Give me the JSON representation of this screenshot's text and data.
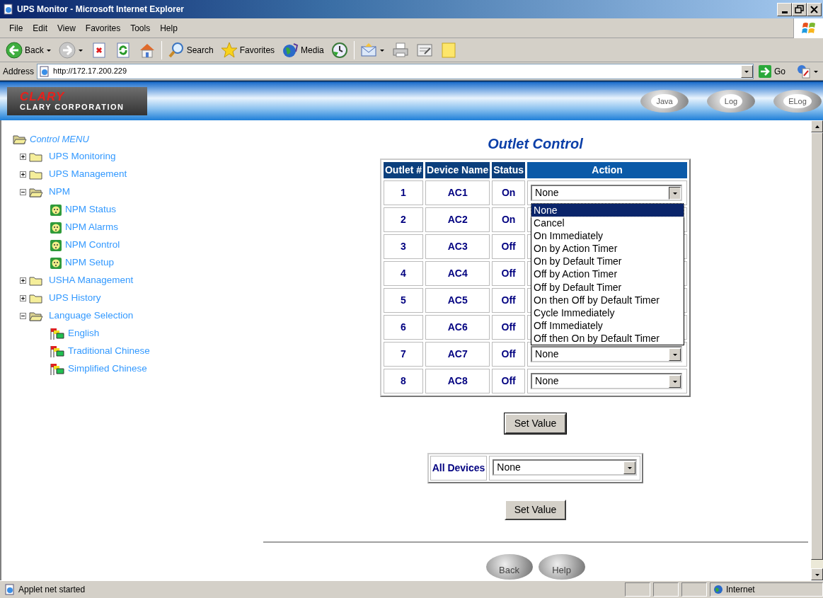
{
  "window": {
    "title": "UPS Monitor - Microsoft Internet Explorer"
  },
  "menu_bar": [
    "File",
    "Edit",
    "View",
    "Favorites",
    "Tools",
    "Help"
  ],
  "toolbar": [
    {
      "kind": "back",
      "label": "Back"
    },
    {
      "kind": "forward"
    },
    {
      "kind": "stop"
    },
    {
      "kind": "refresh"
    },
    {
      "kind": "home"
    },
    {
      "kind": "search",
      "label": "Search"
    },
    {
      "kind": "favorites",
      "label": "Favorites"
    },
    {
      "kind": "media",
      "label": "Media"
    },
    {
      "kind": "history"
    },
    {
      "kind": "mail"
    },
    {
      "kind": "print"
    },
    {
      "kind": "edit"
    },
    {
      "kind": "note"
    }
  ],
  "address_bar": {
    "label": "Address",
    "url": "http://172.17.200.229",
    "go": "Go"
  },
  "header": {
    "logo_mark": "CLARY",
    "logo_text": "CLARY CORPORATION",
    "buttons": [
      "Java",
      "Log",
      "ELog"
    ]
  },
  "sidebar": {
    "root": "Control MENU",
    "items": [
      {
        "label": "UPS Monitoring",
        "expanded": false
      },
      {
        "label": "UPS Management",
        "expanded": false
      },
      {
        "label": "NPM",
        "expanded": true,
        "children": [
          {
            "label": "NPM Status",
            "kind": "outlet"
          },
          {
            "label": "NPM Alarms",
            "kind": "outlet"
          },
          {
            "label": "NPM Control",
            "kind": "outlet"
          },
          {
            "label": "NPM Setup",
            "kind": "outlet"
          }
        ]
      },
      {
        "label": "USHA Management",
        "expanded": false
      },
      {
        "label": "UPS History",
        "expanded": false
      },
      {
        "label": "Language Selection",
        "expanded": true,
        "children": [
          {
            "label": "English",
            "kind": "flag"
          },
          {
            "label": "Traditional Chinese",
            "kind": "flag"
          },
          {
            "label": "Simplified Chinese",
            "kind": "flag"
          }
        ]
      }
    ]
  },
  "outlet_control": {
    "title": "Outlet Control",
    "columns": [
      "Outlet #",
      "Device Name",
      "Status",
      "Action"
    ],
    "rows": [
      {
        "outlet": "1",
        "device": "AC1",
        "status": "On",
        "action": "None",
        "open": true
      },
      {
        "outlet": "2",
        "device": "AC2",
        "status": "On"
      },
      {
        "outlet": "3",
        "device": "AC3",
        "status": "Off"
      },
      {
        "outlet": "4",
        "device": "AC4",
        "status": "Off"
      },
      {
        "outlet": "5",
        "device": "AC5",
        "status": "Off"
      },
      {
        "outlet": "6",
        "device": "AC6",
        "status": "Off"
      },
      {
        "outlet": "7",
        "device": "AC7",
        "status": "Off",
        "action": "None"
      },
      {
        "outlet": "8",
        "device": "AC8",
        "status": "Off",
        "action": "None"
      }
    ],
    "dropdown_options": [
      {
        "label": "None",
        "selected": true
      },
      {
        "label": "Cancel",
        "selected": false
      },
      {
        "label": "On Immediately",
        "selected": false
      },
      {
        "label": "On by Action Timer",
        "selected": false
      },
      {
        "label": "On by Default Timer",
        "selected": false
      },
      {
        "label": "Off by Action Timer",
        "selected": false
      },
      {
        "label": "Off by Default Timer",
        "selected": false
      },
      {
        "label": "On then Off by Default Timer",
        "selected": false
      },
      {
        "label": "Cycle Immediately",
        "selected": false
      },
      {
        "label": "Off Immediately",
        "selected": false
      },
      {
        "label": "Off then On by Default Timer",
        "selected": false
      }
    ],
    "set_value": "Set Value"
  },
  "all_devices": {
    "label": "All Devices",
    "value": "None",
    "set_value": "Set Value"
  },
  "footer_buttons": [
    "Back",
    "Help"
  ],
  "status_bar": {
    "text": "Applet net started",
    "zone": "Internet"
  }
}
